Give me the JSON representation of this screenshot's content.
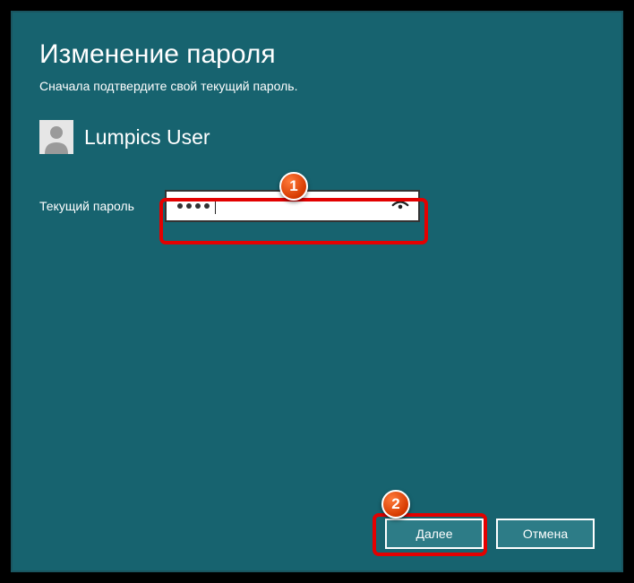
{
  "title": "Изменение пароля",
  "subtitle": "Сначала подтвердите свой текущий пароль.",
  "user_name": "Lumpics User",
  "field_label": "Текущий пароль",
  "password_masked_chars": 4,
  "buttons": {
    "next": "Далее",
    "cancel": "Отмена"
  },
  "callouts": {
    "one": "1",
    "two": "2"
  }
}
